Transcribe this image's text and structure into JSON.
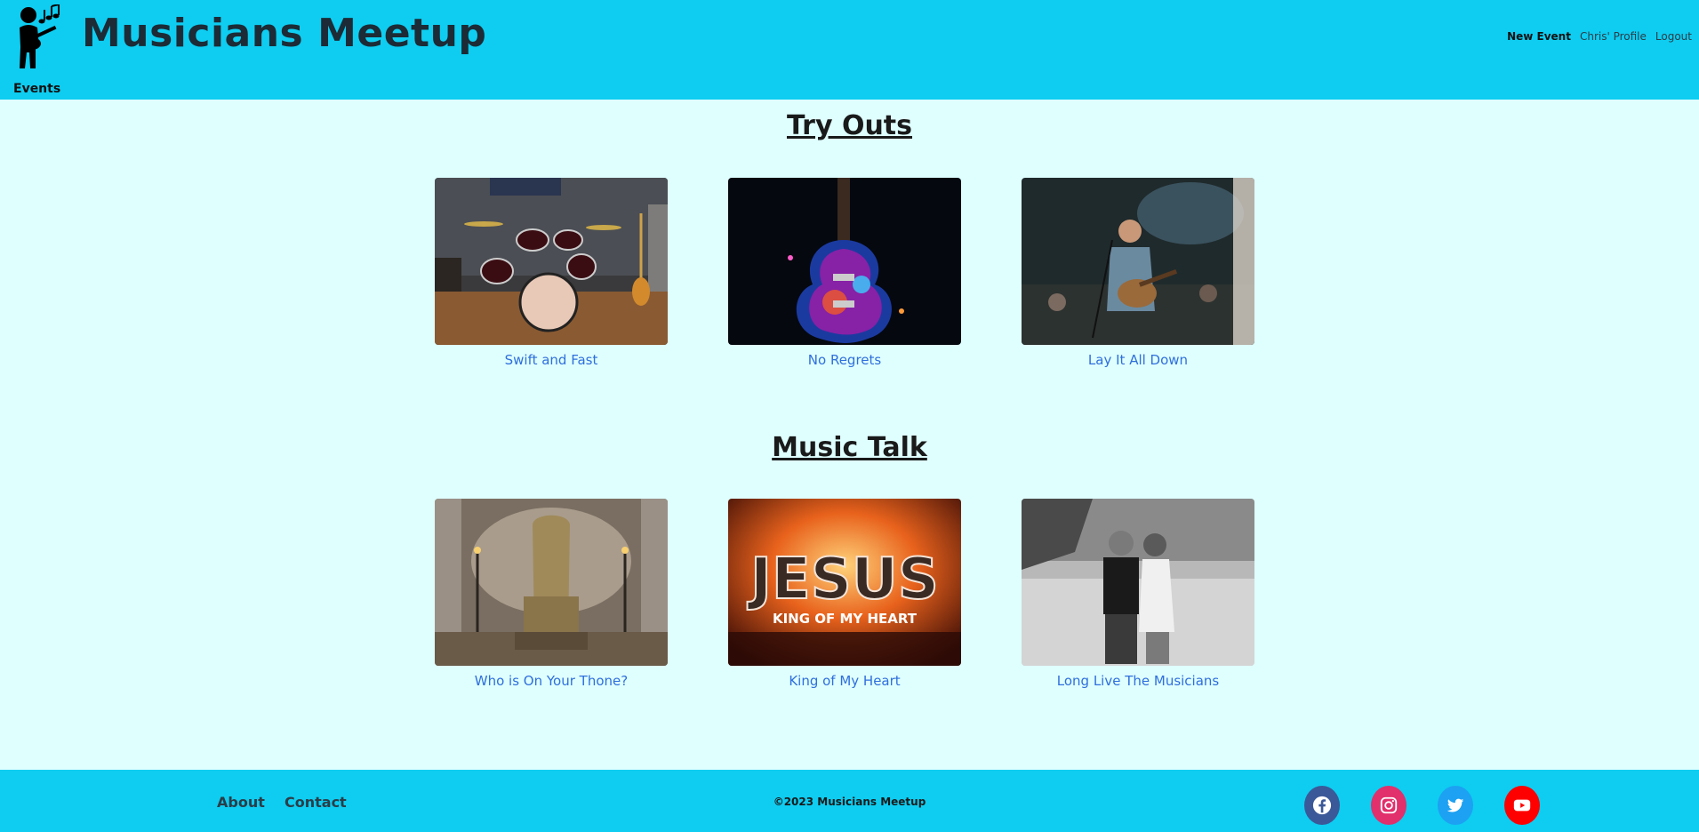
{
  "header": {
    "title": "Musicians Meetup",
    "events_link": "Events",
    "nav": [
      {
        "label": "New Event"
      },
      {
        "label": "Chris' Profile"
      },
      {
        "label": "Logout"
      }
    ]
  },
  "sections": [
    {
      "title": "Try Outs",
      "items": [
        {
          "caption": "Swift and Fast",
          "image": "drum-kit-photo"
        },
        {
          "caption": "No Regrets",
          "image": "neon-guitar-photo"
        },
        {
          "caption": "Lay It All Down",
          "image": "singer-on-stage-photo"
        }
      ]
    },
    {
      "title": "Music Talk",
      "items": [
        {
          "caption": "Who is On Your Thone?",
          "image": "throne-photo"
        },
        {
          "caption": "King of My Heart",
          "image": "jesus-king-of-my-heart-graphic",
          "image_text": [
            "JESUS",
            "KING OF MY HEART"
          ]
        },
        {
          "caption": "Long Live The Musicians",
          "image": "couple-bw-photo"
        }
      ]
    }
  ],
  "footer": {
    "links": [
      {
        "label": "About"
      },
      {
        "label": "Contact"
      }
    ],
    "copyright": "©2023 Musicians Meetup",
    "social": [
      {
        "icon": "facebook-icon",
        "color": "#3b5998"
      },
      {
        "icon": "instagram-icon",
        "color": "#e1306c"
      },
      {
        "icon": "twitter-icon",
        "color": "#1da1f2"
      },
      {
        "icon": "youtube-icon",
        "color": "#ff0000"
      }
    ]
  },
  "colors": {
    "header_bg": "#0ecdf1",
    "page_bg": "#dfffff",
    "link": "#2f6fdc"
  }
}
